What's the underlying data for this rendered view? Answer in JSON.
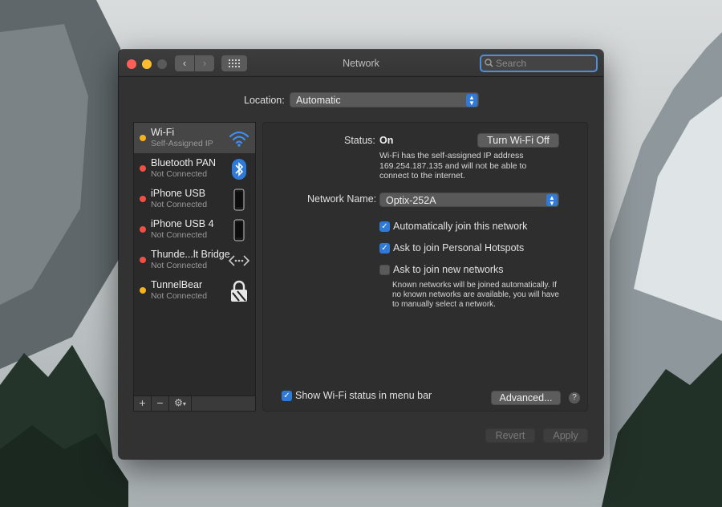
{
  "window": {
    "title": "Network",
    "search_placeholder": "Search"
  },
  "location": {
    "label": "Location:",
    "value": "Automatic"
  },
  "services": [
    {
      "name": "Wi-Fi",
      "status": "Self-Assigned IP",
      "status_color": "#f5b31c",
      "icon": "wifi-icon",
      "selected": true
    },
    {
      "name": "Bluetooth PAN",
      "status": "Not Connected",
      "status_color": "#f04f45",
      "icon": "bluetooth-icon"
    },
    {
      "name": "iPhone USB",
      "status": "Not Connected",
      "status_color": "#f04f45",
      "icon": "iphone-icon"
    },
    {
      "name": "iPhone USB 4",
      "status": "Not Connected",
      "status_color": "#f04f45",
      "icon": "iphone-icon"
    },
    {
      "name": "Thunde...lt Bridge",
      "status": "Not Connected",
      "status_color": "#f04f45",
      "icon": "bridge-icon"
    },
    {
      "name": "TunnelBear",
      "status": "Not Connected",
      "status_color": "#f5b31c",
      "icon": "vpn-lock-icon"
    }
  ],
  "sidebar_toolbar": {
    "add": "+",
    "remove": "−",
    "action": "⚙"
  },
  "detail": {
    "status_label": "Status:",
    "status_value": "On",
    "toggle_button": "Turn Wi-Fi Off",
    "status_description": [
      "Wi-Fi has the self-assigned IP address",
      "169.254.187.135 and will not be able to",
      "connect to the internet."
    ],
    "network_name_label": "Network Name:",
    "network_name_value": "Optix-252A",
    "options": [
      {
        "label": "Automatically join this network",
        "checked": true
      },
      {
        "label": "Ask to join Personal Hotspots",
        "checked": true
      },
      {
        "label": "Ask to join new networks",
        "checked": false
      }
    ],
    "known_networks_note": [
      "Known networks will be joined automatically. If",
      "no known networks are available, you will have",
      "to manually select a network."
    ],
    "show_status_label": "Show Wi-Fi status in menu bar",
    "show_status_checked": true,
    "advanced_button": "Advanced...",
    "help": "?"
  },
  "footer": {
    "revert": "Revert",
    "apply": "Apply"
  },
  "colors": {
    "accent": "#2f7ad9",
    "status_yellow": "#f5b31c",
    "status_red": "#f04f45"
  }
}
